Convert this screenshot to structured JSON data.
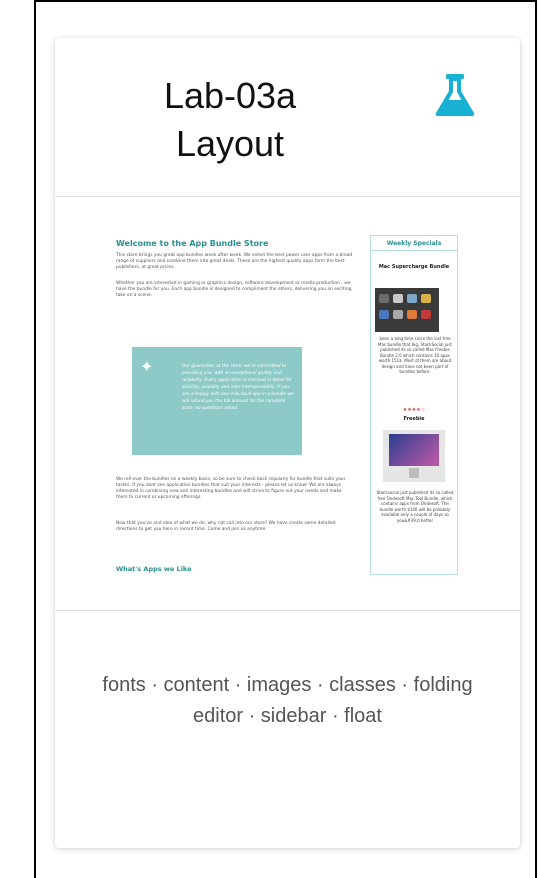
{
  "card": {
    "title_line1": "Lab-03a",
    "title_line2": "Layout",
    "icon": "flask-icon",
    "icon_color": "#19b1d3",
    "tags": "fonts · content · images · classes · folding editor · sidebar · float"
  },
  "preview": {
    "main": {
      "heading": "Welcome to the App Bundle Store",
      "intro": "This store brings you great app bundles week after week. We select the best power user apps from a broad range of suppliers and combine them into great deals. These are the highest quality apps form the best publishers, at great prices.",
      "para2": "Whether you are interested in gaming or graphics design, software development or media production - we have the bundle for you. Each app bundle is designed to compliment the others, delivering you an exciting take on a scene.",
      "quote": "Our guarantee: at the store, we're committed to providing you, with an exceptional quality and reliability. Every application is checked in detail for stability, usability and inter-interoperability. If you are unhappy with any individual app in a bundle we will refund you the full amount for the complete suite, no questions asked.",
      "para3": "We roll over the bundles on a weekly basis, so be sure to check back regularly for bundle that suits your tastes. If you dont see application bundles that suit your interests - please let us know! We are always interested in combining new and interesting bundles and will strive to figure out your needs and make them to current or upcoming offerings.",
      "para4": "Now that you've and idea of what we do, why not call into our store? We have create some detailed directions to get you here in record time. Come and join us anytime.",
      "subheading": "What's Apps we Like"
    },
    "sidebar": {
      "title": "Weekly Specials",
      "item1_title": "Mac Supercharge Bundle",
      "item1_text": "been a long time since the last free Mac bundle that big, StackSocial just published its so called Mac Freebie Bundle 2.0 which contains 10 apps worth 151$. Most of them are about design and have not been part of bundles before.",
      "item1_stars": "★★★★☆",
      "item2_title": "Freebie",
      "item2_text": "Stacksocial just published its so called free Ondesoft Mac Tool Bundle, which contains apps from Ondesoft. The bundle worth $140 will be probably available only a couple of days so you&#39;d better"
    }
  }
}
